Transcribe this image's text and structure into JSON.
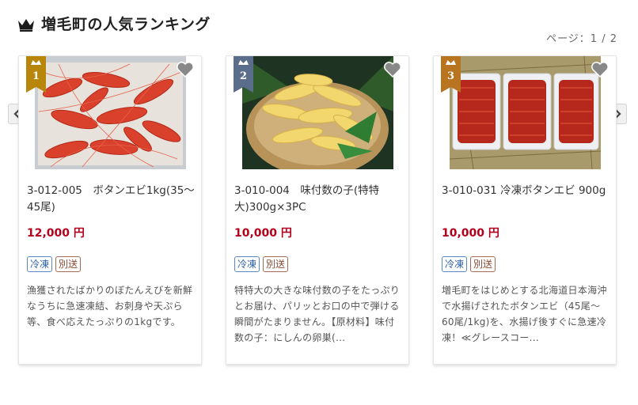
{
  "header": {
    "title": "増毛町の人気ランキング",
    "icon": "crown-icon"
  },
  "pager": {
    "text": "ページ：1 / 2"
  },
  "colors": {
    "accent_price": "#b3001b",
    "rank_gold": "#b8860b",
    "rank_silver": "#5a6e8c",
    "rank_bronze": "#b8741f"
  },
  "products": [
    {
      "rank": "1",
      "name": "3-012-005　ボタンエビ1kg(35〜45尾)",
      "price": "12,000 円",
      "tags": [
        "冷凍",
        "別送"
      ],
      "description": "漁獲されたばかりのぼたんえびを新鮮なうちに急速凍結、お刺身や天ぷら等、食べ応えたっぷりの1kgです。"
    },
    {
      "rank": "2",
      "name": "3-010-004　味付数の子(特特大)300g×3PC",
      "price": "10,000 円",
      "tags": [
        "冷凍",
        "別送"
      ],
      "description": "特特大の大きな味付数の子をたっぷりとお届け、パリッとお口の中で弾ける瞬間がたまりません。【原材料】味付数の子：にしんの卵巣(..."
    },
    {
      "rank": "3",
      "name": "3-010-031 冷凍ボタンエビ 900g",
      "price": "10,000 円",
      "tags": [
        "冷凍",
        "別送"
      ],
      "description": "増毛町をはじめとする北海道日本海沖で水揚げされたボタンエビ（45尾〜60尾/1kg)を、水揚げ後すぐに急速冷凍！≪グレースコー..."
    }
  ]
}
